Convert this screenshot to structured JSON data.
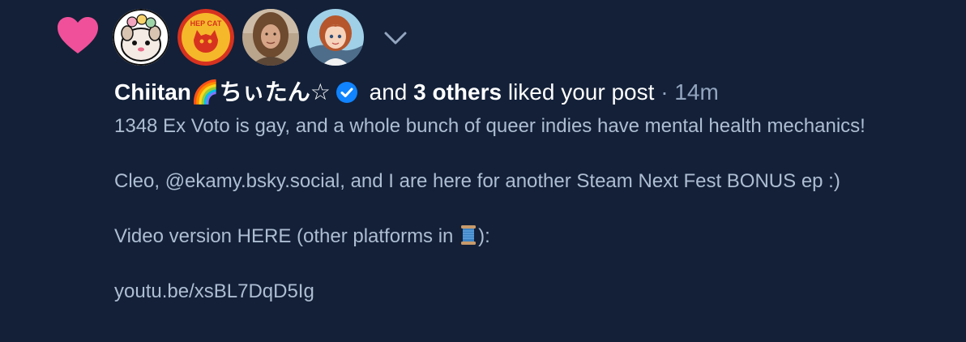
{
  "notification": {
    "actor_name": "Chiitan🌈ちぃたん☆",
    "connector": "and",
    "others": "3 others",
    "action": "liked your post",
    "separator": "·",
    "time": "14m"
  },
  "post": {
    "line1": "1348 Ex Voto is gay, and a whole bunch of queer indies have mental health mechanics!",
    "line2": "Cleo, @ekamy.bsky.social, and I are here for another Steam Next Fest BONUS ep :)",
    "line3_before": "Video version HERE (other platforms in ",
    "line3_after": "):",
    "line4": "youtu.be/xsBL7DqD5Ig"
  },
  "avatars": {
    "badge_text": "HEP CAT"
  },
  "icons": {
    "heart": "heart-icon",
    "verified": "verified-check-icon",
    "expand": "chevron-down-icon",
    "spool": "spool-of-thread-icon"
  },
  "colors": {
    "background": "#132038",
    "heart": "#f0509a",
    "verified": "#1083fe",
    "text": "#ffffff",
    "muted": "#93a5bf",
    "body_text": "#aebdd2"
  }
}
